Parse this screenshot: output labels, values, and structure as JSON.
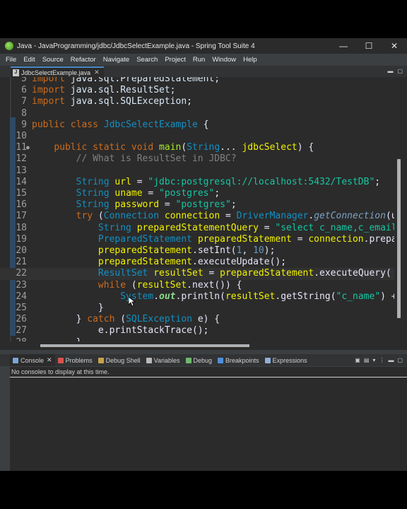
{
  "window": {
    "title": "Java - JavaProgramming/jdbc/JdbcSelectExample.java - Spring Tool Suite 4",
    "minimize": "—",
    "maximize": "☐",
    "close": "✕"
  },
  "menu": [
    "File",
    "Edit",
    "Source",
    "Refactor",
    "Navigate",
    "Search",
    "Project",
    "Run",
    "Window",
    "Help"
  ],
  "editor_tab": {
    "label": "JdbcSelectExample.java",
    "close": "✕"
  },
  "code_lines": [
    {
      "n": "5",
      "t": "import java.sql.PreparedStatement;"
    },
    {
      "n": "6",
      "t": "import java.sql.ResultSet;"
    },
    {
      "n": "7",
      "t": "import java.sql.SQLException;"
    },
    {
      "n": "8",
      "t": ""
    },
    {
      "n": "9",
      "t": "public class JdbcSelectExample {"
    },
    {
      "n": "10",
      "t": ""
    },
    {
      "n": "11",
      "t": "    public static void main(String... jdbcSelect) {"
    },
    {
      "n": "12",
      "t": "        // What is ResultSet in JDBC?"
    },
    {
      "n": "13",
      "t": ""
    },
    {
      "n": "14",
      "t": "        String url = \"jdbc:postgresql://localhost:5432/TestDB\";"
    },
    {
      "n": "15",
      "t": "        String uname = \"postgres\";"
    },
    {
      "n": "16",
      "t": "        String password = \"postgres\";"
    },
    {
      "n": "17",
      "t": "        try (Connection connection = DriverManager.getConnection(u"
    },
    {
      "n": "18",
      "t": "            String preparedStatementQuery = \"select c_name,c_email"
    },
    {
      "n": "19",
      "t": "            PreparedStatement preparedStatement = connection.prepa"
    },
    {
      "n": "20",
      "t": "            preparedStatement.setInt(1, 10);"
    },
    {
      "n": "21",
      "t": "            preparedStatement.executeUpdate();"
    },
    {
      "n": "22",
      "t": "            ResultSet resultSet = preparedStatement.executeQuery("
    },
    {
      "n": "23",
      "t": "            while (resultSet.next()) {"
    },
    {
      "n": "24",
      "t": "                System.out.println(resultSet.getString(\"c_name\") +"
    },
    {
      "n": "25",
      "t": "            }"
    },
    {
      "n": "26",
      "t": "        } catch (SQLException e) {"
    },
    {
      "n": "27",
      "t": "            e.printStackTrace();"
    },
    {
      "n": "28",
      "t": "        }"
    }
  ],
  "console_tabs": [
    {
      "label": "Console",
      "active": true,
      "icon": "console-icon"
    },
    {
      "label": "Problems",
      "icon": "problems-icon"
    },
    {
      "label": "Debug Shell",
      "icon": "debug-shell-icon"
    },
    {
      "label": "Variables",
      "icon": "variables-icon"
    },
    {
      "label": "Debug",
      "icon": "debug-icon"
    },
    {
      "label": "Breakpoints",
      "icon": "breakpoints-icon"
    },
    {
      "label": "Expressions",
      "icon": "expressions-icon"
    }
  ],
  "console_close": "✕",
  "console_message": "No consoles to display at this time.",
  "colors": {
    "keyword": "#cc6c1d",
    "type": "#1290c3",
    "variable": "#f2f200",
    "method": "#a7ec21",
    "string": "#17c6a3",
    "comment": "#808080",
    "editor_bg": "#2b2b2b"
  }
}
